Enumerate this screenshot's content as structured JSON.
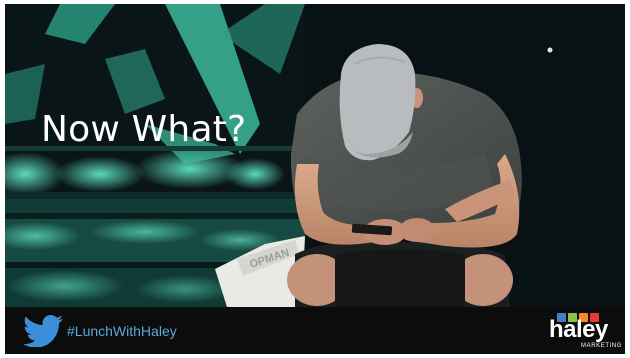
{
  "slide": {
    "headline": "Now What?"
  },
  "photo": {
    "bag_print": "OPMAN"
  },
  "footer": {
    "icon": "twitter-bird-icon",
    "hashtag": "#LunchWithHaley",
    "logo": {
      "word": "haley",
      "subtitle": "MARKETING",
      "square_colors": [
        "#3f7fc4",
        "#8bc34a",
        "#f28c28",
        "#e53935"
      ]
    }
  },
  "colors": {
    "twitter_blue": "#3b8fd9",
    "hashtag_blue": "#5aa8e0",
    "teal_light": "#4fd1b3",
    "background_dark": "#0a1416",
    "footer_bar": "#0c0c0c"
  }
}
